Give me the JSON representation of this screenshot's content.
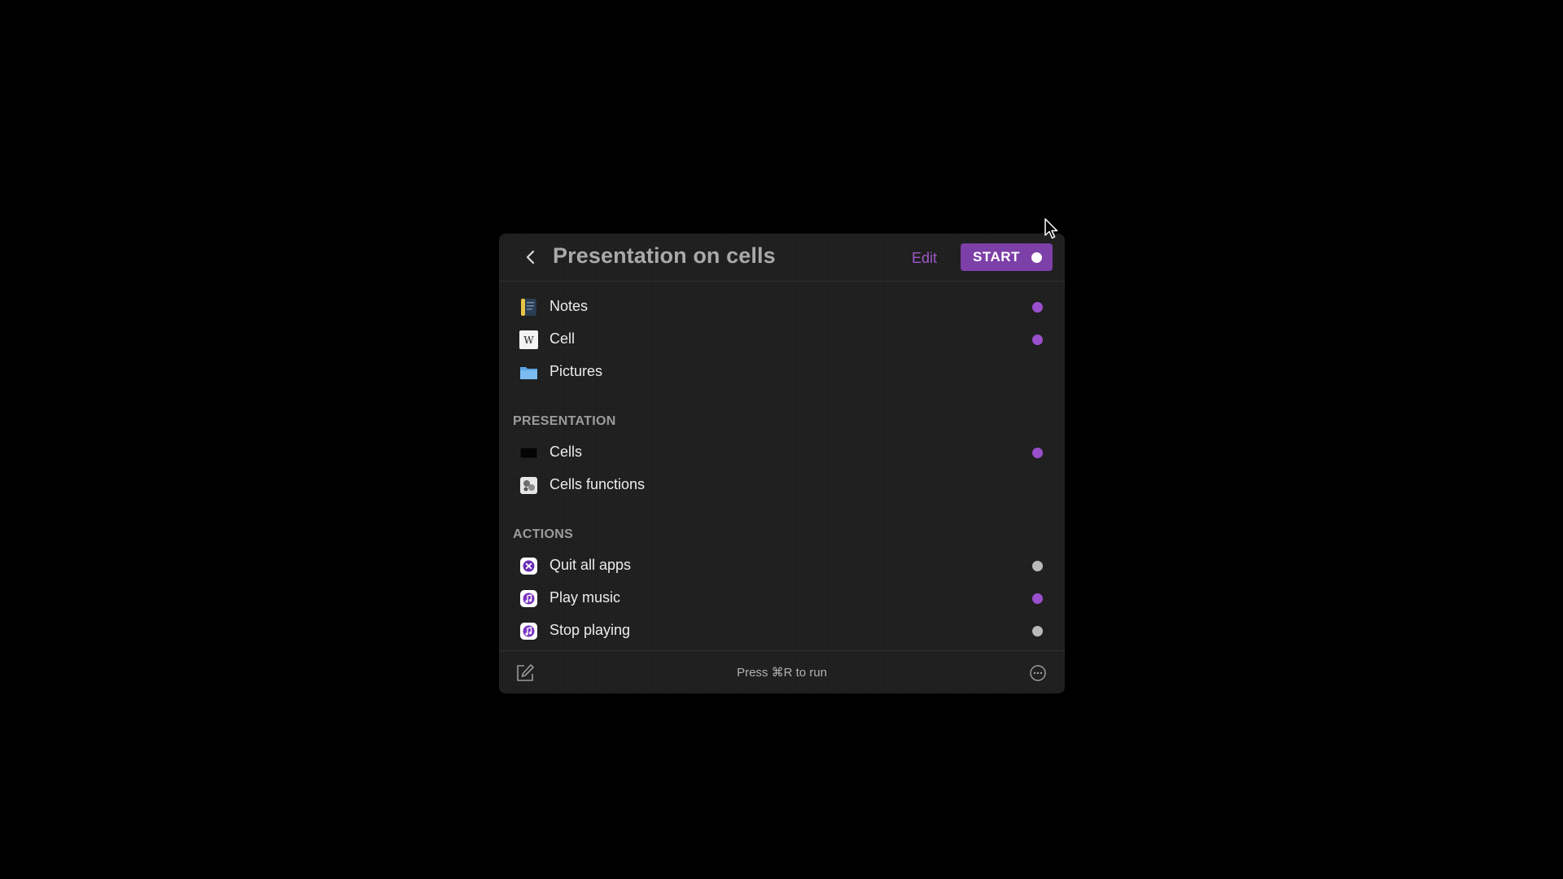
{
  "header": {
    "title": "Presentation on cells",
    "edit_label": "Edit",
    "start_label": "START"
  },
  "items": [
    {
      "label": "Notes",
      "icon": "notes-app-icon",
      "status": "active"
    },
    {
      "label": "Cell",
      "icon": "wikipedia-icon",
      "status": "active"
    },
    {
      "label": "Pictures",
      "icon": "folder-icon",
      "status": "none"
    }
  ],
  "sections": [
    {
      "title": "PRESENTATION",
      "items": [
        {
          "label": "Cells",
          "icon": "keynote-file-icon",
          "status": "active"
        },
        {
          "label": "Cells functions",
          "icon": "image-file-icon",
          "status": "none"
        }
      ]
    },
    {
      "title": "ACTIONS",
      "items": [
        {
          "label": "Quit all apps",
          "icon": "quit-shortcut-icon",
          "status": "inactive"
        },
        {
          "label": "Play music",
          "icon": "music-shortcut-icon",
          "status": "active"
        },
        {
          "label": "Stop playing",
          "icon": "music-shortcut-icon",
          "status": "inactive"
        }
      ]
    }
  ],
  "footer": {
    "hint": "Press ⌘R to run"
  },
  "colors": {
    "accent": "#7d3fa8",
    "active_dot": "#9a4fcc",
    "inactive_dot": "#b9b9b9",
    "panel_bg": "#1d1d1d",
    "screen_bg": "#000000"
  }
}
